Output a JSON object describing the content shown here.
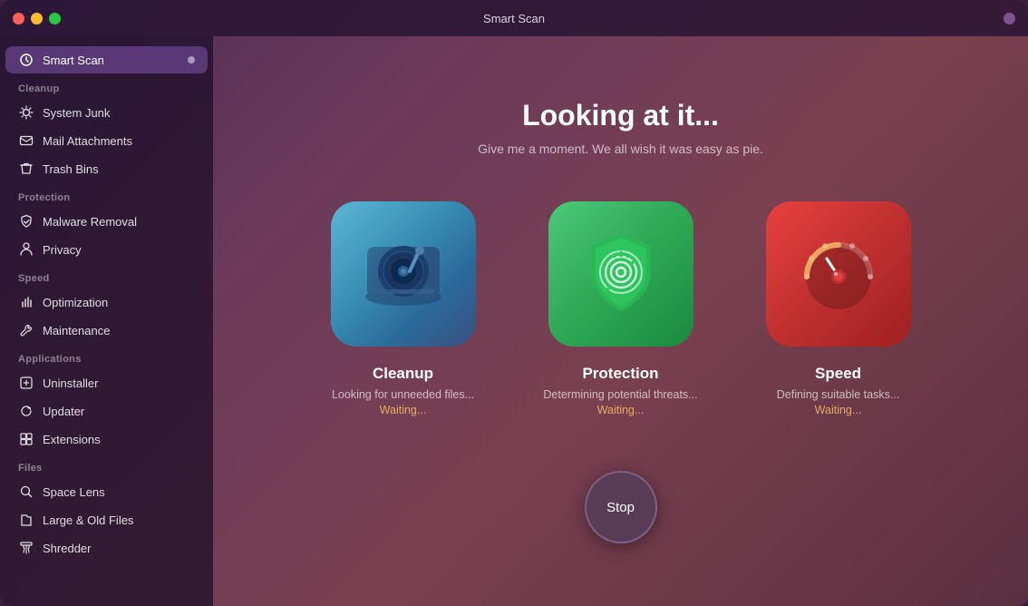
{
  "window": {
    "title": "Smart Scan"
  },
  "sidebar": {
    "active_item": "smart-scan",
    "smart_scan_label": "Smart Scan",
    "sections": [
      {
        "id": "cleanup",
        "label": "Cleanup",
        "items": [
          {
            "id": "system-junk",
            "label": "System Junk",
            "icon": "⚙"
          },
          {
            "id": "mail-attachments",
            "label": "Mail Attachments",
            "icon": "✉"
          },
          {
            "id": "trash-bins",
            "label": "Trash Bins",
            "icon": "🗑"
          }
        ]
      },
      {
        "id": "protection",
        "label": "Protection",
        "items": [
          {
            "id": "malware-removal",
            "label": "Malware Removal",
            "icon": "⚡"
          },
          {
            "id": "privacy",
            "label": "Privacy",
            "icon": "✋"
          }
        ]
      },
      {
        "id": "speed",
        "label": "Speed",
        "items": [
          {
            "id": "optimization",
            "label": "Optimization",
            "icon": "⚡"
          },
          {
            "id": "maintenance",
            "label": "Maintenance",
            "icon": "🔧"
          }
        ]
      },
      {
        "id": "applications",
        "label": "Applications",
        "items": [
          {
            "id": "uninstaller",
            "label": "Uninstaller",
            "icon": "📦"
          },
          {
            "id": "updater",
            "label": "Updater",
            "icon": "🔄"
          },
          {
            "id": "extensions",
            "label": "Extensions",
            "icon": "🧩"
          }
        ]
      },
      {
        "id": "files",
        "label": "Files",
        "items": [
          {
            "id": "space-lens",
            "label": "Space Lens",
            "icon": "🔍"
          },
          {
            "id": "large-old-files",
            "label": "Large & Old Files",
            "icon": "📁"
          },
          {
            "id": "shredder",
            "label": "Shredder",
            "icon": "📄"
          }
        ]
      }
    ]
  },
  "content": {
    "headline": "Looking at it...",
    "subheadline": "Give me a moment. We all wish it was easy as pie.",
    "cards": [
      {
        "id": "cleanup",
        "title": "Cleanup",
        "status": "Looking for unneeded files...",
        "waiting": "Waiting..."
      },
      {
        "id": "protection",
        "title": "Protection",
        "status": "Determining potential threats...",
        "waiting": "Waiting..."
      },
      {
        "id": "speed",
        "title": "Speed",
        "status": "Defining suitable tasks...",
        "waiting": "Waiting..."
      }
    ],
    "stop_button_label": "Stop"
  }
}
